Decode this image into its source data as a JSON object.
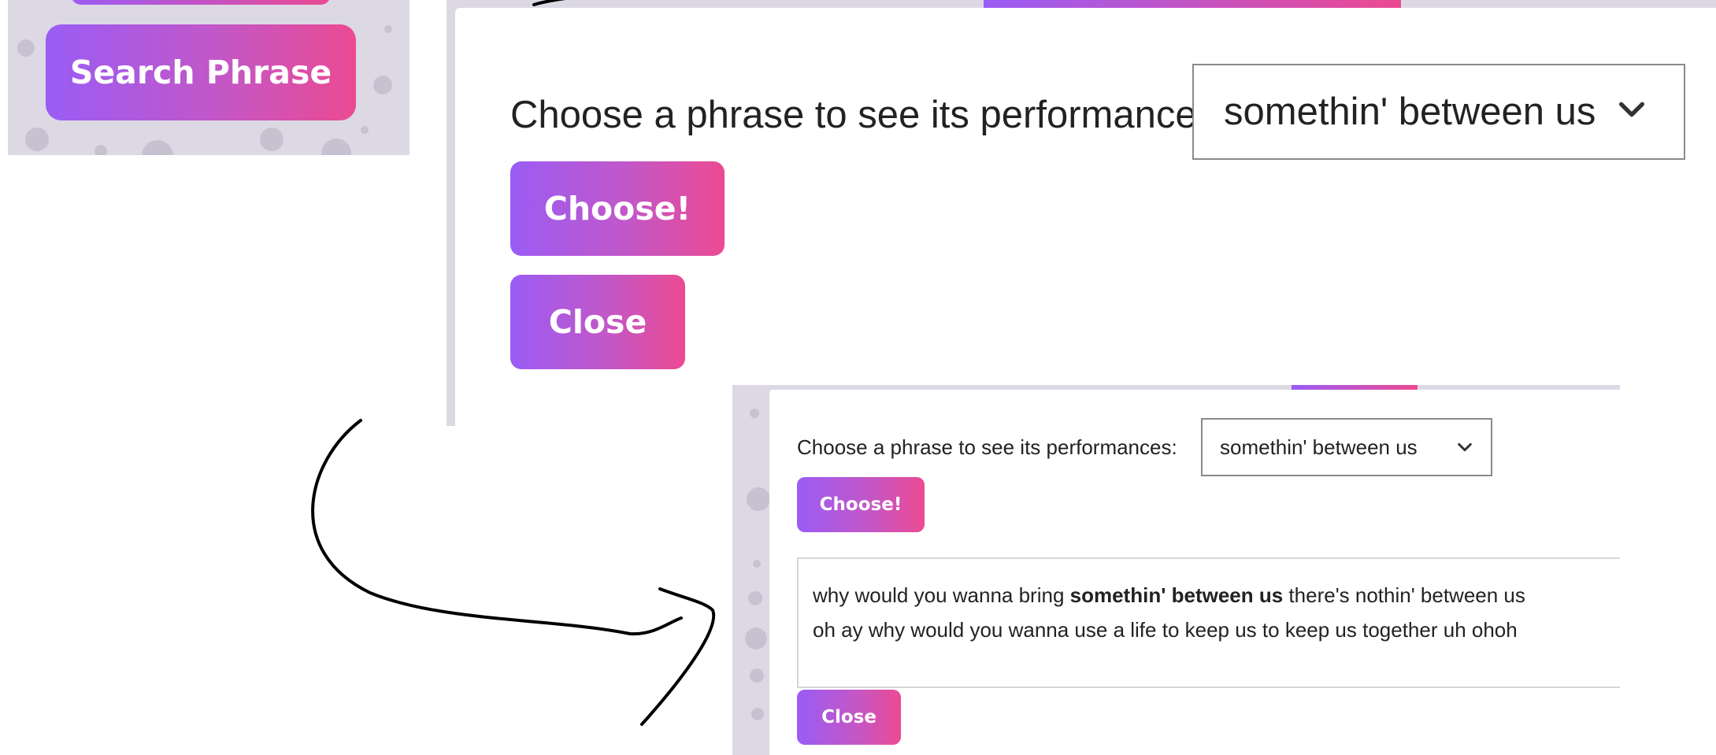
{
  "colors": {
    "button_gradient_start": "#9a5cf5",
    "button_gradient_end": "#ec4a92",
    "dotted_background": "#dcd9e4",
    "text": "#222222"
  },
  "panel1": {
    "search_button_label": "Search Phrase"
  },
  "panel2": {
    "prompt_label": "Choose a phrase to see its performances:",
    "selected_phrase": "somethin' between us",
    "choose_button_label": "Choose!",
    "close_button_label": "Close"
  },
  "panel3": {
    "prompt_label": "Choose a phrase to see its performances:",
    "selected_phrase": "somethin' between us",
    "choose_button_label": "Choose!",
    "result": {
      "line1_before": "why would you wanna bring ",
      "line1_highlight": "somethin' between us",
      "line1_after": " there's nothin' between us",
      "line2": "oh ay why would you wanna use a life to keep us to keep us together uh ohoh"
    },
    "close_button_label": "Close"
  },
  "icons": {
    "dropdown": "chevron-down-icon",
    "annotation": "hand-drawn-arrow"
  }
}
